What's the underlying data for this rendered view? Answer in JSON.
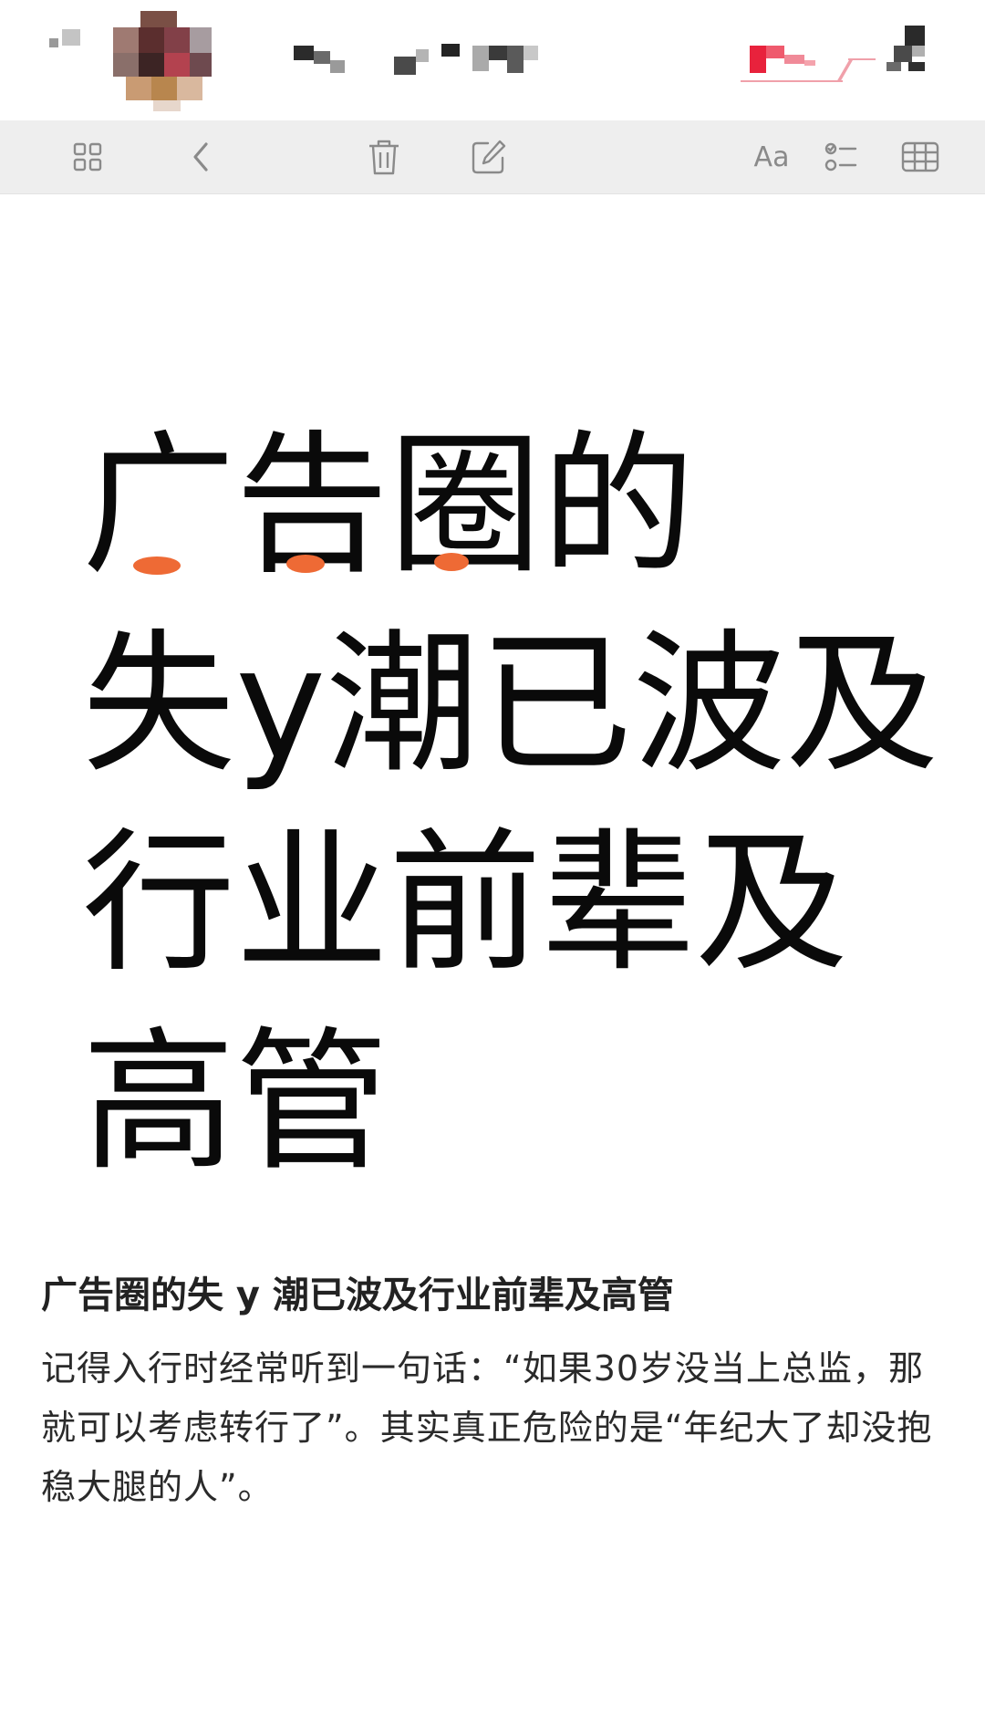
{
  "toolbar": {
    "buttons": {
      "gallery": "gallery-icon",
      "back": "chevron-left-icon",
      "delete": "trash-icon",
      "compose": "compose-icon",
      "format": "Aa",
      "checklist": "checklist-icon",
      "table": "table-icon"
    },
    "icon_color": "#8a8a8a"
  },
  "note": {
    "title_lines": [
      "广告圈的",
      "失y潮已波及",
      "行业前辈及",
      "高管"
    ],
    "heading": "广告圈的失 y 潮已波及行业前辈及高管",
    "paragraph": "记得入行时经常听到一句话：“如果30岁没当上总监，那就可以考虑转行了”。其实真正危险的是“年纪大了却没抱稳大腿的人”。"
  },
  "colors": {
    "toolbar_bg": "#eeeeee",
    "scribble_mark": "#ee6a35",
    "brand_red": "#e8223c"
  }
}
